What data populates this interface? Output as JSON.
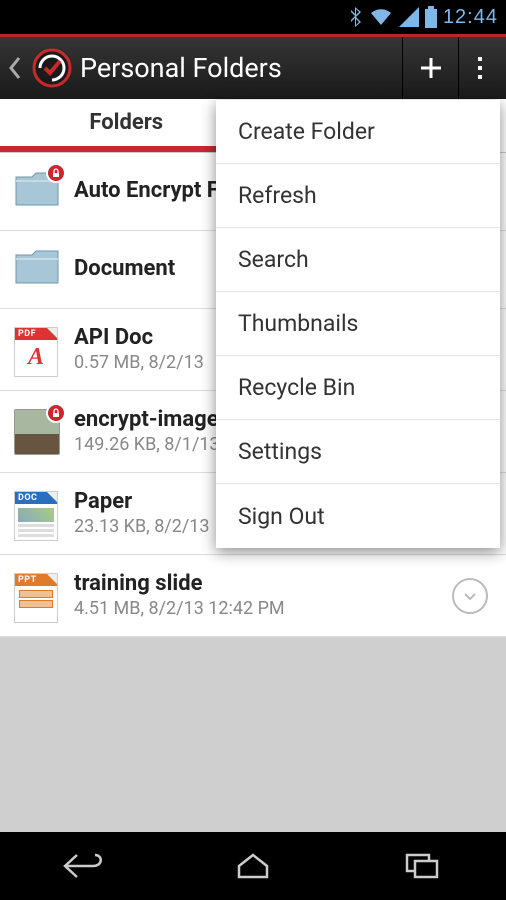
{
  "status": {
    "time": "12:44"
  },
  "app_bar": {
    "title": "Personal Folders"
  },
  "tabs": {
    "folders": "Folders",
    "remote_hidden": ""
  },
  "menu": {
    "items": [
      {
        "label": "Create Folder"
      },
      {
        "label": "Refresh"
      },
      {
        "label": "Search"
      },
      {
        "label": "Thumbnails"
      },
      {
        "label": "Recycle Bin"
      },
      {
        "label": "Settings"
      },
      {
        "label": "Sign Out"
      }
    ]
  },
  "list": {
    "items": [
      {
        "kind": "folder",
        "name": "Auto Encrypt Folder",
        "locked": true
      },
      {
        "kind": "folder",
        "name": "Document",
        "locked": false
      },
      {
        "kind": "file",
        "name": "API Doc",
        "ext": "pdf",
        "meta": "0.57 MB, 8/2/13"
      },
      {
        "kind": "file",
        "name": "encrypt-image",
        "ext": "img",
        "meta": "149.26 KB, 8/1/13",
        "locked": true
      },
      {
        "kind": "file",
        "name": "Paper",
        "ext": "doc",
        "meta": "23.13 KB, 8/2/13"
      },
      {
        "kind": "file",
        "name": "training slide",
        "ext": "ppt",
        "meta": "4.51 MB, 8/2/13  12:42 PM"
      }
    ]
  }
}
